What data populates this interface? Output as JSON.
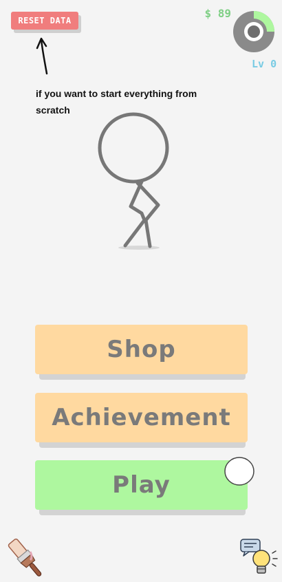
{
  "header": {
    "reset_label": "RESET DATA",
    "money": "$ 89",
    "level": "Lv 0",
    "level_progress": 0.25
  },
  "hint": {
    "text": "if you want to start everything from scratch"
  },
  "menu": {
    "shop_label": "Shop",
    "achievement_label": "Achievement",
    "play_label": "Play"
  },
  "colors": {
    "reset": "#f07d7d",
    "money": "#7fcf85",
    "level": "#78cbe3",
    "orange_button": "#ffd9a0",
    "green_button": "#aef79f"
  },
  "icons": {
    "bottom_left": "paint-brush-icon",
    "bottom_right": "lightbulb-chat-icon"
  }
}
